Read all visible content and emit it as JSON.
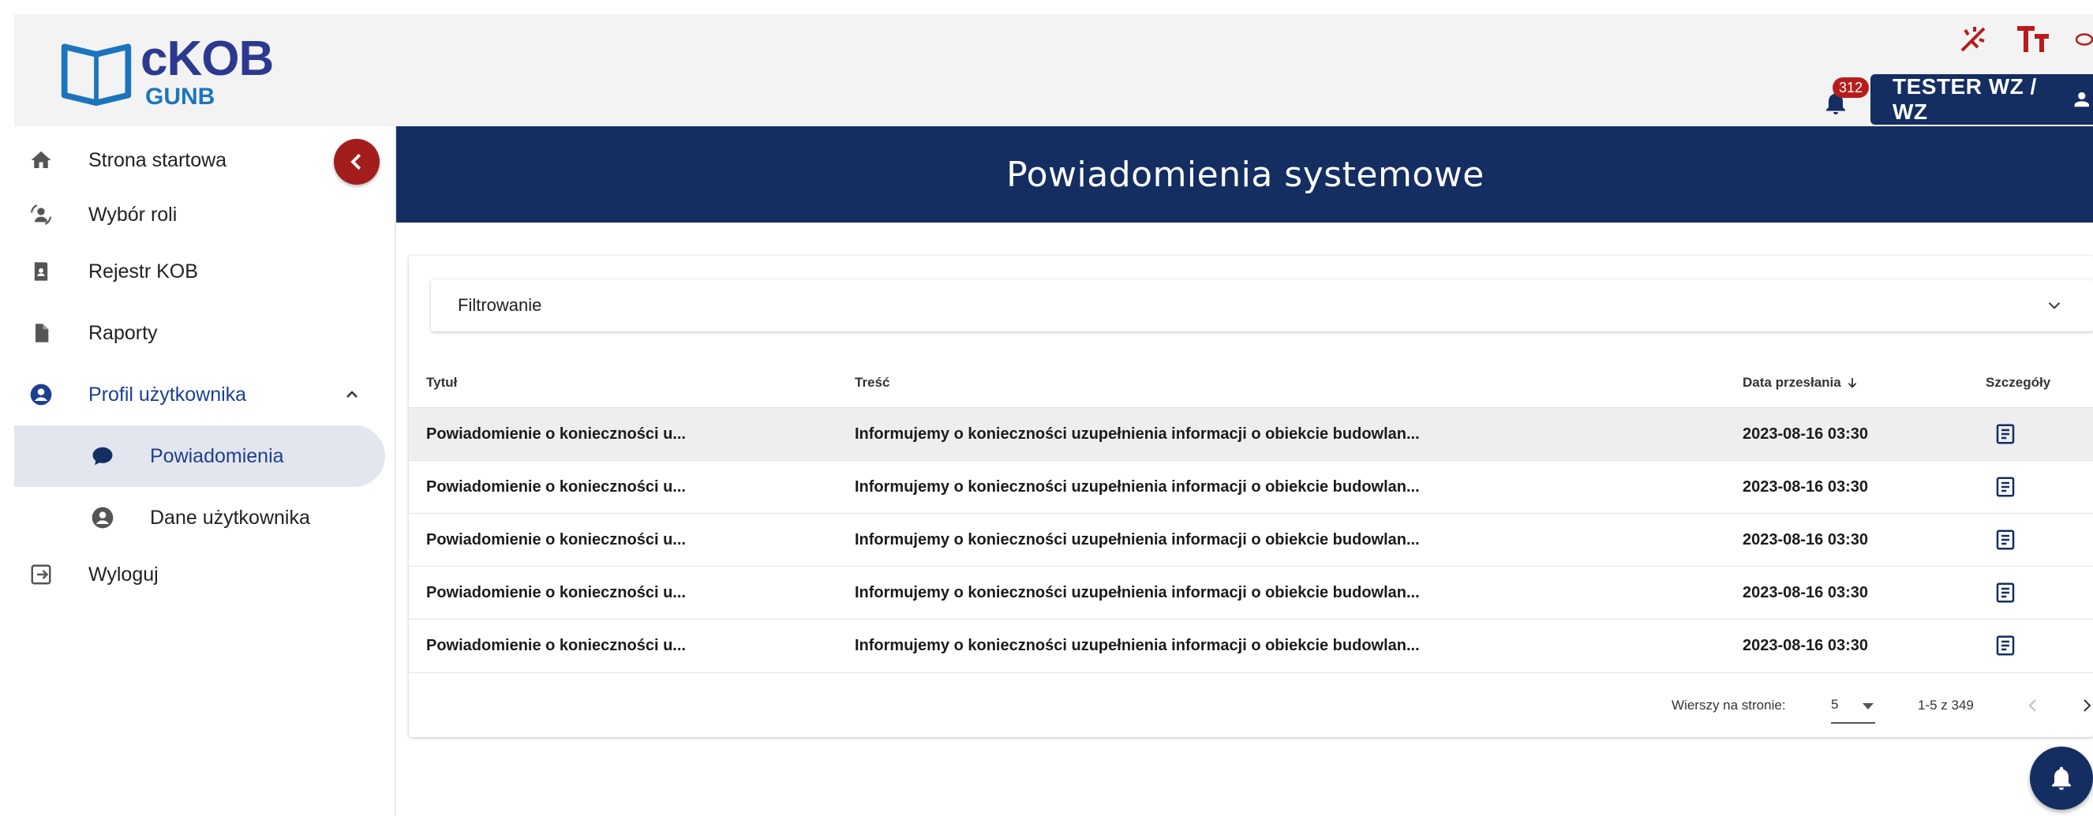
{
  "header": {
    "logo": {
      "main": "cKOB",
      "sub": "GUNB"
    },
    "notifications_count": "312",
    "user_label": "TESTER WZ / WZ"
  },
  "sidebar": {
    "items": [
      {
        "label": "Strona startowa",
        "icon": "home-icon"
      },
      {
        "label": "Wybór roli",
        "icon": "role-switch-icon"
      },
      {
        "label": "Rejestr KOB",
        "icon": "register-book-icon"
      },
      {
        "label": "Raporty",
        "icon": "report-file-icon"
      },
      {
        "label": "Profil użytkownika",
        "icon": "account-circle-icon"
      },
      {
        "label": "Powiadomienia",
        "icon": "chat-bubble-icon"
      },
      {
        "label": "Dane użytkownika",
        "icon": "account-circle-icon"
      },
      {
        "label": "Wyloguj",
        "icon": "logout-icon"
      }
    ]
  },
  "main": {
    "title": "Powiadomienia systemowe",
    "filter_label": "Filtrowanie",
    "columns": [
      "Tytuł",
      "Treść",
      "Data przesłania",
      "Szczegóły"
    ],
    "rows": [
      {
        "title": "Powiadomienie o konieczności u...",
        "content": "Informujemy o konieczności uzupełnienia informacji o obiekcie budowlan...",
        "date": "2023-08-16 03:30"
      },
      {
        "title": "Powiadomienie o konieczności u...",
        "content": "Informujemy o konieczności uzupełnienia informacji o obiekcie budowlan...",
        "date": "2023-08-16 03:30"
      },
      {
        "title": "Powiadomienie o konieczności u...",
        "content": "Informujemy o konieczności uzupełnienia informacji o obiekcie budowlan...",
        "date": "2023-08-16 03:30"
      },
      {
        "title": "Powiadomienie o konieczności u...",
        "content": "Informujemy o konieczności uzupełnienia informacji o obiekcie budowlan...",
        "date": "2023-08-16 03:30"
      },
      {
        "title": "Powiadomienie o konieczności u...",
        "content": "Informujemy o konieczności uzupełnienia informacji o obiekcie budowlan...",
        "date": "2023-08-16 03:30"
      }
    ],
    "pagination": {
      "rows_per_page_label": "Wierszy na stronie:",
      "rows_per_page": "5",
      "range": "1-5 z 349"
    }
  },
  "colors": {
    "primary": "#142e62",
    "accent_red": "#a31d1d",
    "logo_blue": "#2b3990",
    "logo_light": "#1c75bc"
  }
}
